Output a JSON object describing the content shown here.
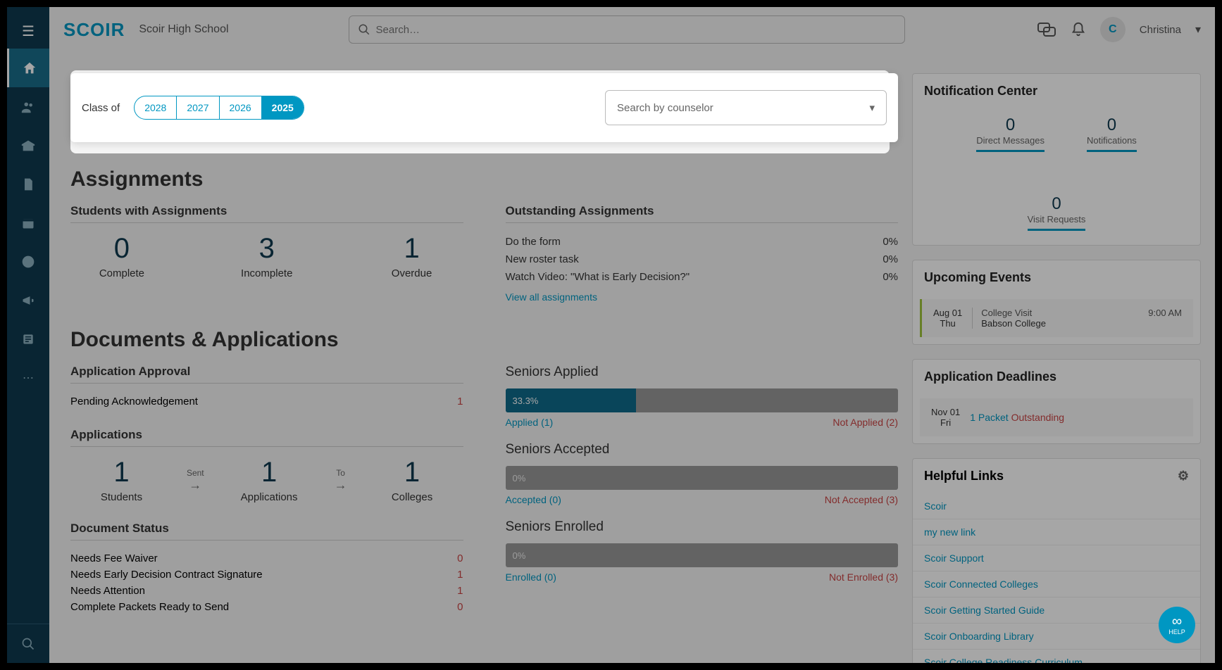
{
  "brand": "SCOIR",
  "school": "Scoir High School",
  "search_placeholder": "Search…",
  "user": {
    "initial": "C",
    "name": "Christina"
  },
  "filter": {
    "label": "Class of",
    "years": [
      "2028",
      "2027",
      "2026",
      "2025"
    ],
    "active_year": "2025",
    "counselor_placeholder": "Search by counselor"
  },
  "assignments": {
    "title": "Assignments",
    "students_h": "Students with Assignments",
    "stats": [
      {
        "value": "0",
        "label": "Complete"
      },
      {
        "value": "3",
        "label": "Incomplete"
      },
      {
        "value": "1",
        "label": "Overdue"
      }
    ],
    "outstanding_h": "Outstanding Assignments",
    "items": [
      {
        "name": "Do the form",
        "pct": "0%"
      },
      {
        "name": "New roster task",
        "pct": "0%"
      },
      {
        "name": "Watch Video: \"What is Early Decision?\"",
        "pct": "0%"
      }
    ],
    "view_all": "View all assignments"
  },
  "docs": {
    "title": "Documents & Applications",
    "approval_h": "Application Approval",
    "pending_label": "Pending Acknowledgement",
    "pending_count": "1",
    "apps_h": "Applications",
    "app_stats": {
      "students": "1",
      "students_label": "Students",
      "sent": "Sent",
      "applications": "1",
      "applications_label": "Applications",
      "to": "To",
      "colleges": "1",
      "colleges_label": "Colleges"
    },
    "doc_status_h": "Document Status",
    "doc_rows": [
      {
        "label": "Needs Fee Waiver",
        "count": "0",
        "red": true
      },
      {
        "label": "Needs Early Decision Contract Signature",
        "count": "1",
        "red": true
      },
      {
        "label": "Needs Attention",
        "count": "1",
        "red": true
      },
      {
        "label": "Complete Packets Ready to Send",
        "count": "0",
        "red": true
      }
    ],
    "seniors_applied": {
      "title": "Seniors Applied",
      "pct": "33.3%",
      "fill": 33.3,
      "left": "Applied (1)",
      "right": "Not Applied (2)"
    },
    "seniors_accepted": {
      "title": "Seniors Accepted",
      "pct": "0%",
      "fill": 0,
      "left": "Accepted (0)",
      "right": "Not Accepted (3)"
    },
    "seniors_enrolled": {
      "title": "Seniors Enrolled",
      "pct": "0%",
      "fill": 0,
      "left": "Enrolled (0)",
      "right": "Not Enrolled (3)"
    }
  },
  "notif": {
    "title": "Notification Center",
    "tabs": [
      {
        "num": "0",
        "label": "Direct Messages"
      },
      {
        "num": "0",
        "label": "Notifications"
      },
      {
        "num": "0",
        "label": "Visit Requests"
      }
    ]
  },
  "events": {
    "title": "Upcoming Events",
    "item": {
      "date": "Aug 01",
      "day": "Thu",
      "type": "College Visit",
      "college": "Babson College",
      "time": "9:00 AM"
    }
  },
  "deadlines": {
    "title": "Application Deadlines",
    "item": {
      "date": "Nov 01",
      "day": "Fri",
      "packet_n": "1 Packet",
      "packet_status": "Outstanding"
    }
  },
  "links": {
    "title": "Helpful Links",
    "items": [
      "Scoir",
      "my new link",
      "Scoir Support",
      "Scoir Connected Colleges",
      "Scoir Getting Started Guide",
      "Scoir Onboarding Library",
      "Scoir College Readiness Curriculum"
    ]
  },
  "help_fab": "HELP"
}
